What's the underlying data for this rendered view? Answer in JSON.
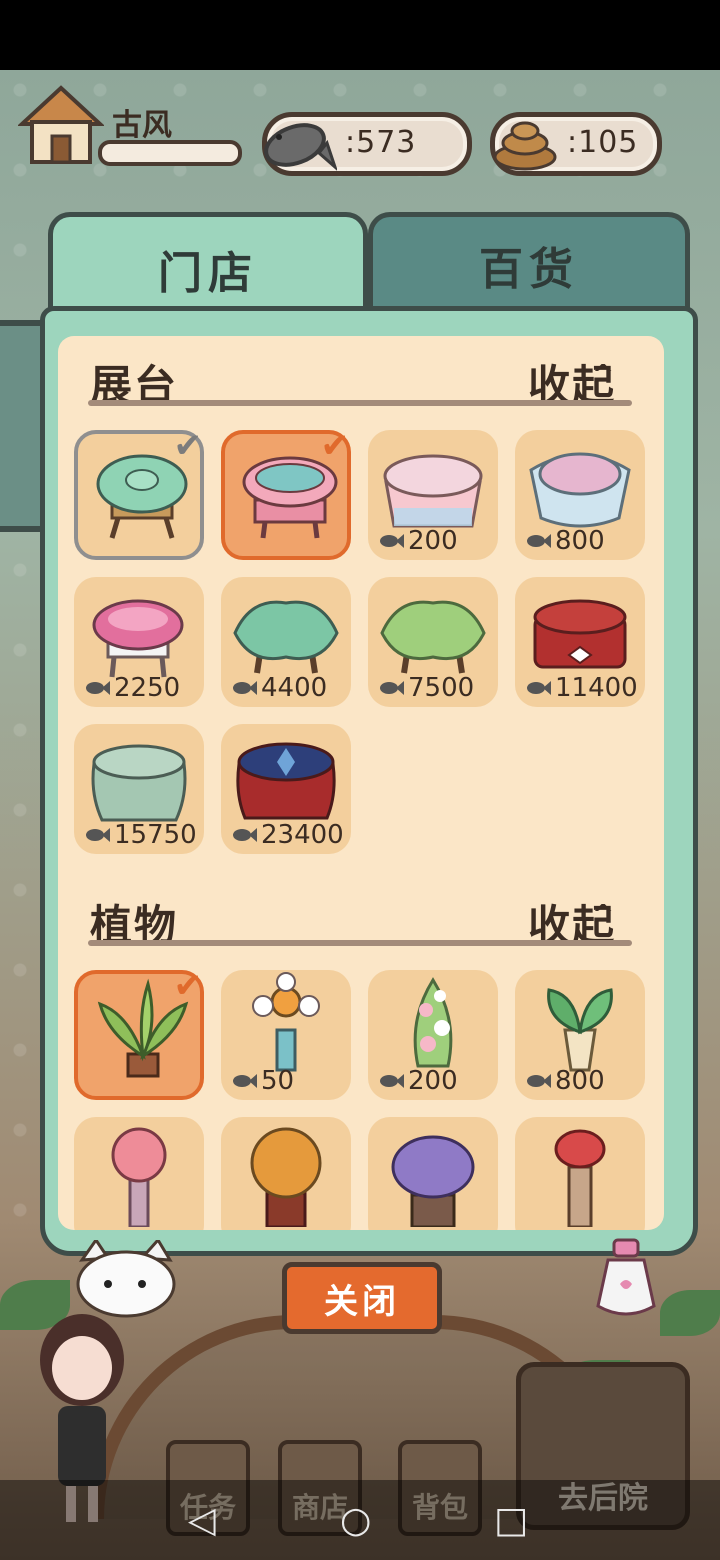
{
  "hud": {
    "player_name": "古风",
    "fish_currency": ":573",
    "coin_currency": ":105"
  },
  "tabs": [
    {
      "label": "门店",
      "active": true
    },
    {
      "label": "百货",
      "active": false
    }
  ],
  "sections": [
    {
      "title": "展台",
      "collapse_label": "收起",
      "items": [
        {
          "name": "green-flower-stool",
          "price": "",
          "selected": "gray"
        },
        {
          "name": "pink-cushion-stool",
          "price": "",
          "selected": "orange"
        },
        {
          "name": "pink-tablecloth-table",
          "price": "200"
        },
        {
          "name": "lace-pedestal",
          "price": "800"
        },
        {
          "name": "pink-frill-stool",
          "price": "2250"
        },
        {
          "name": "mint-clover-table",
          "price": "4400"
        },
        {
          "name": "green-clover-table",
          "price": "7500"
        },
        {
          "name": "red-bow-table",
          "price": "11400"
        },
        {
          "name": "jade-drum-stool",
          "price": "15750"
        },
        {
          "name": "red-velvet-pouf",
          "price": "23400"
        }
      ]
    },
    {
      "title": "植物",
      "collapse_label": "收起",
      "items": [
        {
          "name": "potted-palm",
          "price": "",
          "selected": "orange"
        },
        {
          "name": "sunflower-vase",
          "price": "50"
        },
        {
          "name": "rose-topiary",
          "price": "200"
        },
        {
          "name": "monstera-urn",
          "price": "800"
        },
        {
          "name": "pink-flower-vase",
          "price": ""
        },
        {
          "name": "orange-flower-pot",
          "price": ""
        },
        {
          "name": "purple-flower-pot",
          "price": ""
        },
        {
          "name": "red-flower-pedestal",
          "price": ""
        }
      ]
    }
  ],
  "close_label": "关闭",
  "bottom_nav": {
    "tasks": "任务",
    "shop": "商店",
    "backpack": "背包",
    "backyard": "去后院"
  },
  "colors": {
    "panel": "#9dd5bd",
    "panel_inner": "#fbe6c7",
    "item_bg": "#f3cf9d",
    "selected_orange": "#f0a36b",
    "close_button": "#e46a2e"
  }
}
